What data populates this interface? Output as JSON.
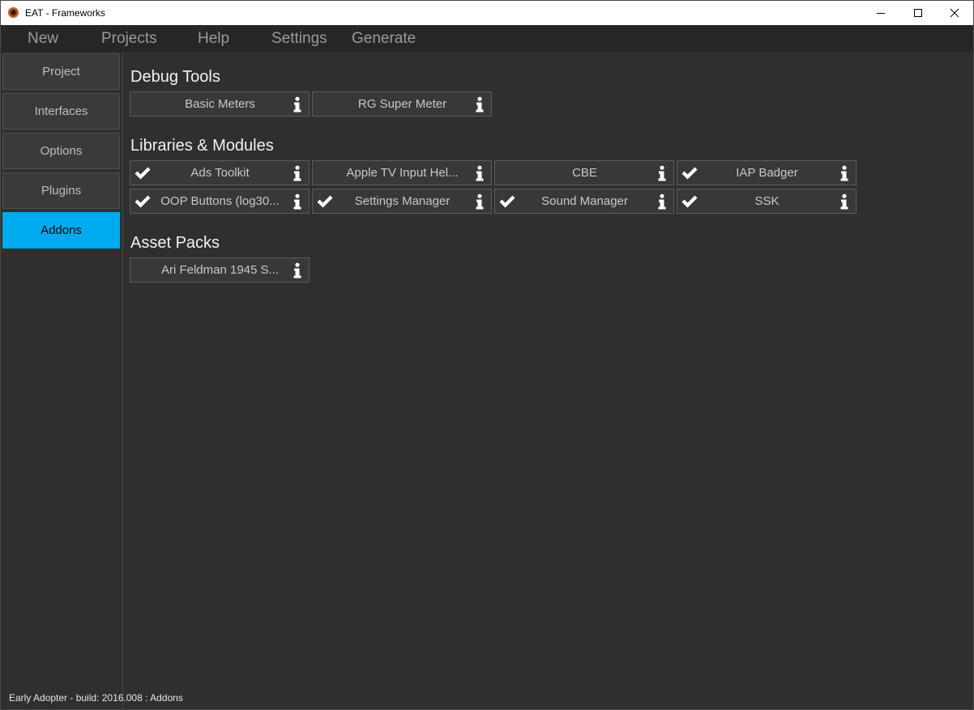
{
  "window": {
    "title": "EAT - Frameworks"
  },
  "menu": {
    "items": [
      "New",
      "Projects",
      "Help",
      "Settings",
      "Generate"
    ]
  },
  "sidebar": {
    "items": [
      {
        "label": "Project",
        "active": false
      },
      {
        "label": "Interfaces",
        "active": false
      },
      {
        "label": "Options",
        "active": false
      },
      {
        "label": "Plugins",
        "active": false
      },
      {
        "label": "Addons",
        "active": true
      }
    ]
  },
  "sections": {
    "debug_tools": {
      "title": "Debug Tools",
      "items": [
        {
          "label": "Basic Meters",
          "checked": false
        },
        {
          "label": "RG Super Meter",
          "checked": false
        }
      ]
    },
    "libraries": {
      "title": "Libraries & Modules",
      "items": [
        {
          "label": "Ads Toolkit",
          "checked": true
        },
        {
          "label": "Apple TV Input Hel...",
          "checked": false
        },
        {
          "label": "CBE",
          "checked": false
        },
        {
          "label": "IAP Badger",
          "checked": true
        },
        {
          "label": "OOP Buttons (log30...",
          "checked": true
        },
        {
          "label": "Settings Manager",
          "checked": true
        },
        {
          "label": "Sound Manager",
          "checked": true
        },
        {
          "label": "SSK",
          "checked": true
        }
      ]
    },
    "asset_packs": {
      "title": "Asset Packs",
      "items": [
        {
          "label": "Ari Feldman 1945 S...",
          "checked": false
        }
      ]
    }
  },
  "status_bar": {
    "text": "Early Adopter - build: 2016.008 : Addons"
  },
  "colors": {
    "accent": "#00aaee",
    "background": "#2f2f2f",
    "menubar": "#262626"
  },
  "icons": {
    "check": "check-icon",
    "info": "info-icon"
  }
}
